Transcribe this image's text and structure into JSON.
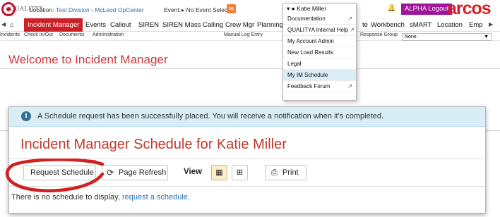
{
  "topbar": {
    "logo_text": "QUALITYX",
    "location_label": "Location:",
    "location_value": "Test Division › McLeod OpCenter",
    "event_label": "Event:",
    "event_value": "▸ No Event Selected",
    "logout_label": "ALPHA Logout",
    "brand": "arcos"
  },
  "nav": {
    "items": [
      "Incident Manager",
      "Events",
      "Callout",
      "SIREN",
      "SIREN Mass Calling",
      "Crew Mgr",
      "Planning",
      "te",
      "Workbench",
      "sMART",
      "Location",
      "Emp"
    ]
  },
  "subnav": {
    "items": [
      "Incidents",
      "Check In/Out",
      "Documents",
      "Administration",
      "Manual Log Entry",
      "Response Group"
    ],
    "response_group_value": "None"
  },
  "main": {
    "welcome": "Welcome to Incident Manager"
  },
  "user_menu": {
    "user_name": "Katie Miller",
    "items": [
      {
        "label": "Documentation"
      },
      {
        "label": "QUALITYA Internal Help"
      },
      {
        "label": "My Account Admin"
      },
      {
        "label": "New Load Results"
      },
      {
        "label": "Legal"
      },
      {
        "label": "My IM Schedule"
      },
      {
        "label": "Feedback Forum"
      }
    ]
  },
  "panel": {
    "alert_text": "A Schedule request has been successfully placed. You will receive a notification when it's completed.",
    "title": "Incident Manager Schedule for Katie Miller",
    "request_button": "Request Schedule",
    "refresh_button": "Page Refresh",
    "view_label": "View",
    "print_button": "Print",
    "empty_text": "There is no schedule to display,",
    "empty_link": "request a schedule",
    "empty_suffix": "."
  },
  "colors": {
    "brand_red": "#cc1f26",
    "logout_purple": "#a0149b",
    "alert_bg": "#d9edf7",
    "link_blue": "#2a6fb0"
  },
  "icons": {
    "home": "home-icon",
    "refresh": "refresh-icon",
    "calendar": "calendar-icon",
    "grid": "grid-icon",
    "print": "print-icon",
    "info": "info-icon",
    "bell": "bell-icon",
    "external": "external-link-icon"
  }
}
